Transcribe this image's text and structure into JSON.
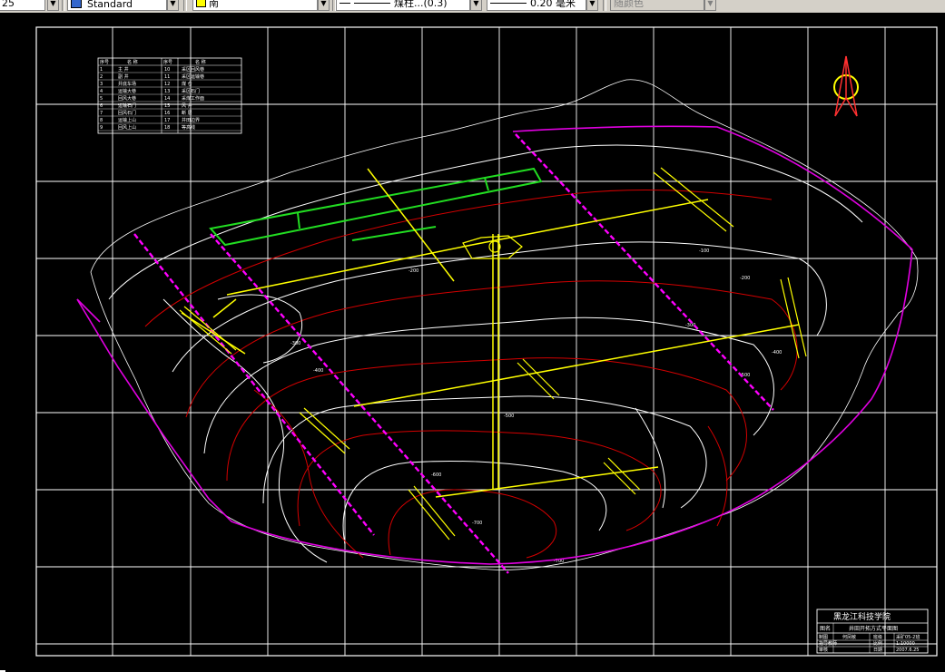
{
  "toolbar": {
    "text_style_partial": "25",
    "dim_style": "Standard",
    "layer": "南",
    "linetype": "煤柱...(0.3)",
    "lineweight": "0.20 毫米",
    "plot_style": "随颜色"
  },
  "drawing": {
    "legend_title_row": [
      "序号",
      "名  称",
      "序号",
      "名  称"
    ],
    "legend_rows": [
      [
        "1",
        "主  井",
        "10",
        "采区回风巷"
      ],
      [
        "2",
        "副  井",
        "11",
        "采区运输巷"
      ],
      [
        "3",
        "井底车场",
        "12",
        "煤  仓"
      ],
      [
        "4",
        "运输大巷",
        "13",
        "采区石门"
      ],
      [
        "5",
        "回风大巷",
        "14",
        "采煤工作面"
      ],
      [
        "6",
        "运输石门",
        "15",
        "风  井"
      ],
      [
        "7",
        "回风石门",
        "16",
        "断  层"
      ],
      [
        "8",
        "运输上山",
        "17",
        "井田边界"
      ],
      [
        "9",
        "回风上山",
        "18",
        "等高线"
      ]
    ],
    "contour_labels": [
      "-100",
      "-200",
      "-300",
      "-400",
      "-500",
      "-600",
      "-700"
    ],
    "title_block": {
      "institution": "黑龙江科技学院",
      "drawing_name_label": "图名",
      "drawing_name": "井田开拓方式平面图",
      "row2": [
        "制图",
        "何凤敏",
        "班级",
        "采矿05-2班"
      ],
      "row3": [
        "指导教师",
        "",
        "比例",
        "1:10000"
      ],
      "row4": [
        "审核",
        "",
        "日期",
        "2007.6.25"
      ]
    }
  }
}
